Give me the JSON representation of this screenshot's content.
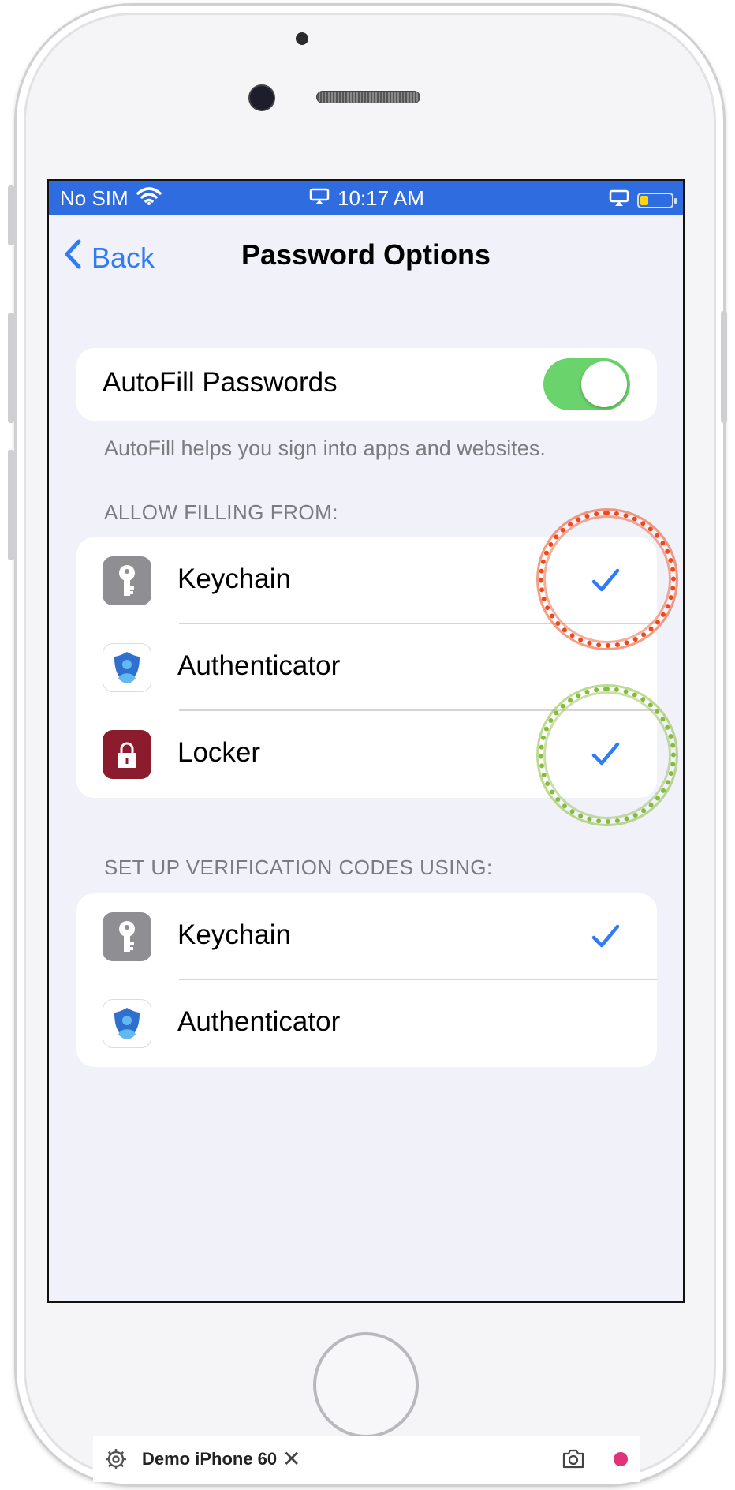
{
  "status_bar": {
    "carrier": "No SIM",
    "time": "10:17 AM",
    "battery_color": "#ffd60a"
  },
  "nav": {
    "back_label": "Back",
    "title": "Password Options"
  },
  "autofill": {
    "label": "AutoFill Passwords",
    "enabled": true,
    "footnote": "AutoFill helps you sign into apps and websites."
  },
  "allow_filling": {
    "header": "ALLOW FILLING FROM:",
    "items": [
      {
        "label": "Keychain",
        "icon": "keychain-icon",
        "checked": true
      },
      {
        "label": "Authenticator",
        "icon": "authenticator-icon",
        "checked": false
      },
      {
        "label": "Locker",
        "icon": "locker-icon",
        "checked": true
      }
    ]
  },
  "verification": {
    "header": "SET UP VERIFICATION CODES USING:",
    "items": [
      {
        "label": "Keychain",
        "icon": "keychain-icon",
        "checked": true
      },
      {
        "label": "Authenticator",
        "icon": "authenticator-icon",
        "checked": false
      }
    ]
  },
  "toolbar": {
    "device_name": "Demo iPhone 60",
    "close_glyph": "✕"
  },
  "colors": {
    "accent": "#2f7cf6",
    "status_bar": "#2f6ce0",
    "toggle_on": "#6bd36c",
    "annotation_red": "#ec4a1c",
    "annotation_green": "#86bb3b",
    "record": "#e0337a"
  }
}
